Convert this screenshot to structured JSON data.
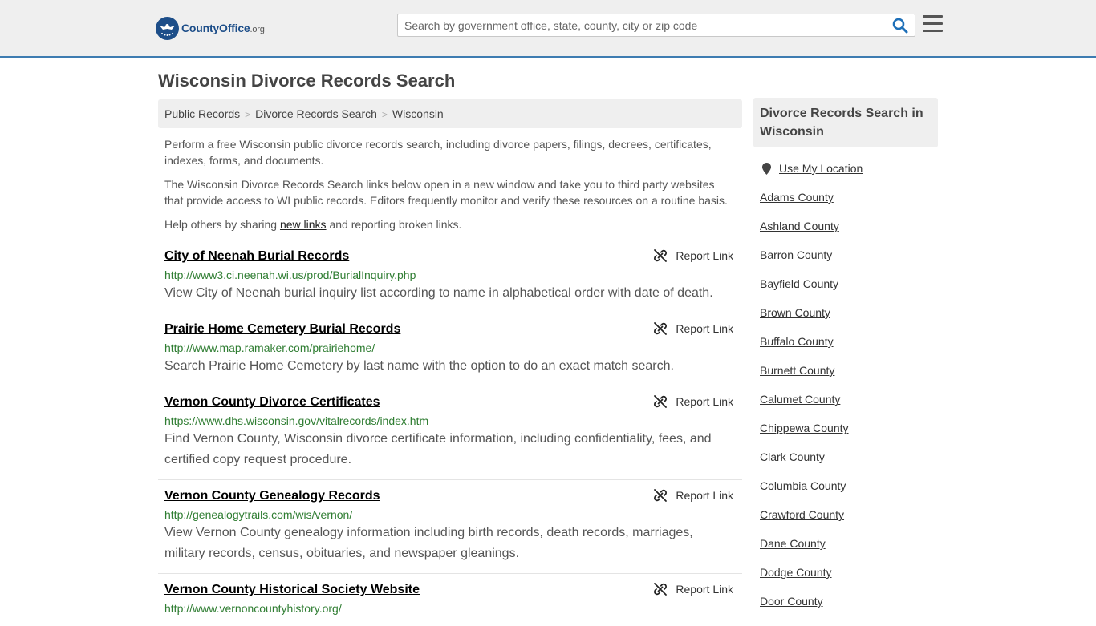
{
  "header": {
    "logo_main": "CountyOffice",
    "logo_tld": ".org",
    "search_placeholder": "Search by government office, state, county, city or zip code"
  },
  "page": {
    "title": "Wisconsin Divorce Records Search"
  },
  "breadcrumb": [
    "Public Records",
    "Divorce Records Search",
    "Wisconsin"
  ],
  "intro": {
    "p1": "Perform a free Wisconsin public divorce records search, including divorce papers, filings, decrees, certificates, indexes, forms, and documents.",
    "p2": "The Wisconsin Divorce Records Search links below open in a new window and take you to third party websites that provide access to WI public records. Editors frequently monitor and verify these resources on a routine basis.",
    "p3_before": "Help others by sharing ",
    "p3_link": "new links",
    "p3_after": " and reporting broken links."
  },
  "report_label": "Report Link",
  "results": [
    {
      "title": "City of Neenah Burial Records",
      "url": "http://www3.ci.neenah.wi.us/prod/BurialInquiry.php",
      "desc": "View City of Neenah burial inquiry list according to name in alphabetical order with date of death."
    },
    {
      "title": "Prairie Home Cemetery Burial Records",
      "url": "http://www.map.ramaker.com/prairiehome/",
      "desc": "Search Prairie Home Cemetery by last name with the option to do an exact match search."
    },
    {
      "title": "Vernon County Divorce Certificates",
      "url": "https://www.dhs.wisconsin.gov/vitalrecords/index.htm",
      "desc": "Find Vernon County, Wisconsin divorce certificate information, including confidentiality, fees, and certified copy request procedure."
    },
    {
      "title": "Vernon County Genealogy Records",
      "url": "http://genealogytrails.com/wis/vernon/",
      "desc": "View Vernon County genealogy information including birth records, death records, marriages, military records, census, obituaries, and newspaper gleanings."
    },
    {
      "title": "Vernon County Historical Society Website",
      "url": "http://www.vernoncountyhistory.org/",
      "desc": ""
    }
  ],
  "sidebar": {
    "heading": "Divorce Records Search in Wisconsin",
    "use_location": "Use My Location",
    "counties": [
      "Adams County",
      "Ashland County",
      "Barron County",
      "Bayfield County",
      "Brown County",
      "Buffalo County",
      "Burnett County",
      "Calumet County",
      "Chippewa County",
      "Clark County",
      "Columbia County",
      "Crawford County",
      "Dane County",
      "Dodge County",
      "Door County"
    ]
  },
  "colors": {
    "header_bg": "#efefef",
    "header_border": "#3e7cb1",
    "url_green": "#2f7d32",
    "logo_blue": "#1d4e89",
    "search_icon": "#1d6fb8"
  }
}
